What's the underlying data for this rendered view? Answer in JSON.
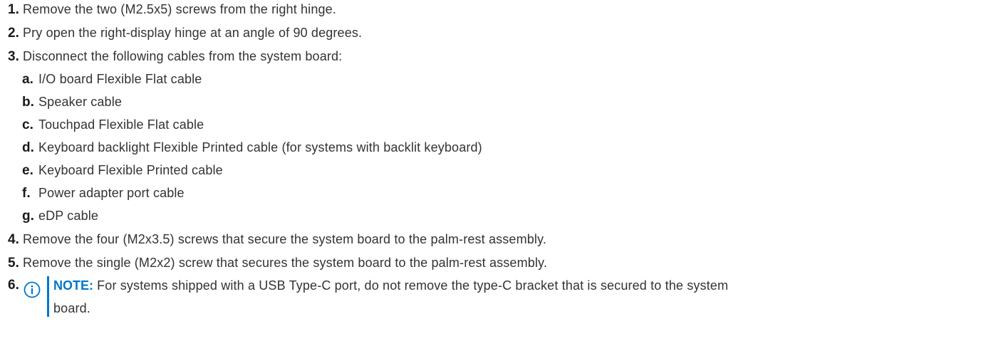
{
  "steps": [
    {
      "num": "1.",
      "text": "Remove the two (M2.5x5) screws from the right hinge."
    },
    {
      "num": "2.",
      "text": "Pry open the right-display hinge at an angle of 90 degrees."
    },
    {
      "num": "3.",
      "text": "Disconnect the following cables from the system board:"
    },
    {
      "num": "4.",
      "text": "Remove the four (M2x3.5) screws that secure the system board to the palm-rest assembly."
    },
    {
      "num": "5.",
      "text": "Remove the single (M2x2) screw that secures the system board to the palm-rest assembly."
    },
    {
      "num": "6.",
      "text": ""
    }
  ],
  "substeps": [
    {
      "num": "a.",
      "text": "I/O board Flexible Flat cable"
    },
    {
      "num": "b.",
      "text": "Speaker cable"
    },
    {
      "num": "c.",
      "text": "Touchpad Flexible Flat cable"
    },
    {
      "num": "d.",
      "text": "Keyboard backlight Flexible Printed cable (for systems with backlit keyboard)"
    },
    {
      "num": "e.",
      "text": "Keyboard Flexible Printed cable"
    },
    {
      "num": "f.",
      "text": "Power adapter port cable"
    },
    {
      "num": "g.",
      "text": "eDP cable"
    }
  ],
  "note": {
    "icon": "info-icon",
    "label": "NOTE:",
    "line1": " For systems shipped with a USB Type-C port, do not remove the type-C bracket that is secured to the system",
    "line2": "board."
  },
  "colors": {
    "accent": "#0076ce",
    "text": "#333333"
  }
}
